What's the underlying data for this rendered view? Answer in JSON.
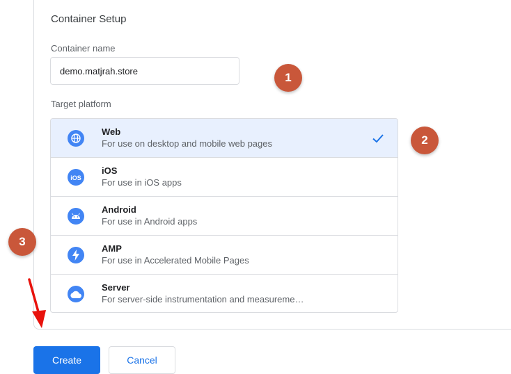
{
  "setup": {
    "title": "Container Setup",
    "container_name_label": "Container name",
    "container_name_value": "demo.matjrah.store",
    "target_platform_label": "Target platform"
  },
  "platforms": [
    {
      "name": "Web",
      "description": "For use on desktop and mobile web pages",
      "icon": "globe-icon",
      "selected": true
    },
    {
      "name": "iOS",
      "description": "For use in iOS apps",
      "icon": "ios-icon",
      "selected": false
    },
    {
      "name": "Android",
      "description": "For use in Android apps",
      "icon": "android-icon",
      "selected": false
    },
    {
      "name": "AMP",
      "description": "For use in Accelerated Mobile Pages",
      "icon": "bolt-icon",
      "selected": false
    },
    {
      "name": "Server",
      "description": "For server-side instrumentation and measureme…",
      "icon": "cloud-icon",
      "selected": false
    }
  ],
  "annotations": {
    "step1": "1",
    "step2": "2",
    "step3": "3"
  },
  "buttons": {
    "create": "Create",
    "cancel": "Cancel"
  },
  "colors": {
    "primary": "#1a73e8",
    "icon_blue": "#4285f4",
    "selected_bg": "#e8f0fe",
    "step_badge": "#c9573a",
    "arrow": "#e8120c"
  }
}
